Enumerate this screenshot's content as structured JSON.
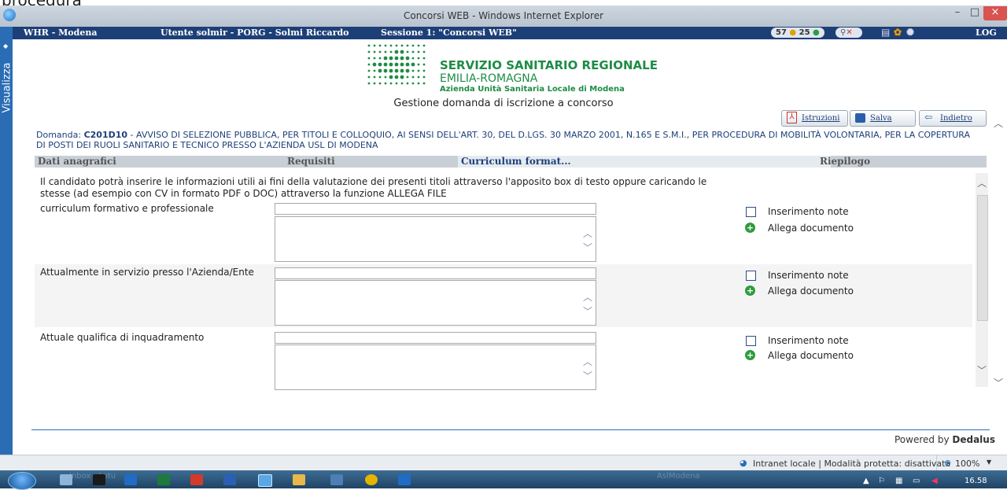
{
  "cropped_text": "procedura",
  "window": {
    "title": "Concorsi WEB - Windows Internet Explorer",
    "minimize": "–",
    "maximize": "□",
    "close": "×"
  },
  "header": {
    "app": "WHR - Modena",
    "user": "Utente solmir - PORG - Solmi Riccardo",
    "session": "Sessione 1: \"Concorsi WEB\"",
    "counter1": "57",
    "counter2": "25",
    "logout": "LOG OUT"
  },
  "sidebar": {
    "label": "Visualizza"
  },
  "logo": {
    "line1": "SERVIZIO SANITARIO REGIONALE",
    "line2": "EMILIA-ROMAGNA",
    "line3": "Azienda Unità Sanitaria Locale di Modena"
  },
  "page_subtitle": "Gestione domanda di iscrizione a concorso",
  "toolbar": {
    "istruzioni": "Istruzioni",
    "salva": "Salva",
    "indietro": "Indietro"
  },
  "domanda": {
    "prefix": "Domanda:",
    "code": "C201D10",
    "text": " - AVVISO DI SELEZIONE PUBBLICA, PER TITOLI E COLLOQUIO, AI SENSI DELL'ART. 30, DEL D.LGS. 30 MARZO 2001, N.165 E S.M.I., PER PROCEDURA DI MOBILITÀ VOLONTARIA, PER LA COPERTURA DI POSTI DEI RUOLI SANITARIO E TECNICO PRESSO L'AZIENDA USL DI MODENA"
  },
  "tabs": [
    "Dati anagrafici",
    "Requisiti",
    "Curriculum format...",
    "Riepilogo"
  ],
  "intro": "Il candidato potrà inserire le informazioni utili ai fini della valutazione dei presenti titoli attraverso l'apposito box di testo oppure caricando le stesse (ad esempio con CV in formato PDF o DOC) attraverso la funzione ALLEGA FILE",
  "rows": [
    {
      "label": "curriculum formativo e professionale",
      "note": "Inserimento note",
      "attach": "Allega documento"
    },
    {
      "label": "Attualmente in servizio presso l'Azienda/Ente",
      "note": "Inserimento note",
      "attach": "Allega documento"
    },
    {
      "label": "Attuale qualifica di inquadramento",
      "note": "Inserimento note",
      "attach": "Allega documento"
    }
  ],
  "footer": {
    "powered_prefix": "Powered by ",
    "powered_brand": "Dedalus"
  },
  "statusbar": {
    "zone": "Intranet locale | Modalità protetta: disattivata",
    "zoom": "100%"
  },
  "taskbar": {
    "ghost1": "Inbox - Lotu",
    "ghost2": "AslModena",
    "clock": "16.58"
  },
  "colors": {
    "header_blue": "#1d3f78",
    "sidebar_blue": "#2a6db5",
    "logo_green": "#1e8c46"
  }
}
